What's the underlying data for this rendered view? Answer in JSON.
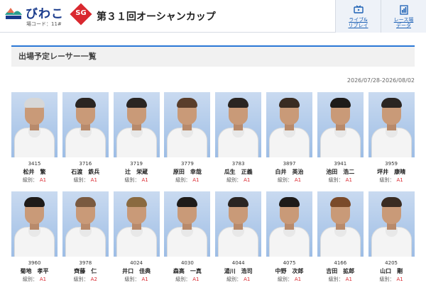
{
  "header": {
    "venue_name": "びわこ",
    "venue_code": "場コード：11#",
    "grade_badge": "SG",
    "race_title": "第３１回オーシャンカップ",
    "buttons": [
      {
        "label_line1": "ライブ&",
        "label_line2": "リプレイ",
        "icon": "tv-icon"
      },
      {
        "label_line1": "レース場",
        "label_line2": "データ",
        "icon": "chart-document-icon"
      }
    ]
  },
  "section": {
    "title": "出場予定レーサー一覧",
    "period": "2026/07/28-2026/08/02"
  },
  "grade_label": "級別：",
  "racers": [
    {
      "number": "3415",
      "name": "松井　繁",
      "class": "A1"
    },
    {
      "number": "3716",
      "name": "石渡　鉄兵",
      "class": "A1"
    },
    {
      "number": "3719",
      "name": "辻　栄蔵",
      "class": "A1"
    },
    {
      "number": "3779",
      "name": "原田　幸哉",
      "class": "A1"
    },
    {
      "number": "3783",
      "name": "瓜生　正義",
      "class": "A1"
    },
    {
      "number": "3897",
      "name": "白井　英治",
      "class": "A1"
    },
    {
      "number": "3941",
      "name": "池田　浩二",
      "class": "A1"
    },
    {
      "number": "3959",
      "name": "坪井　康晴",
      "class": "A1"
    },
    {
      "number": "3960",
      "name": "菊地　孝平",
      "class": "A1"
    },
    {
      "number": "3978",
      "name": "齊藤　仁",
      "class": "A2"
    },
    {
      "number": "4024",
      "name": "井口　佳典",
      "class": "A1"
    },
    {
      "number": "4030",
      "name": "森高　一真",
      "class": "A1"
    },
    {
      "number": "4044",
      "name": "湯川　浩司",
      "class": "A1"
    },
    {
      "number": "4075",
      "name": "中野　次郎",
      "class": "A1"
    },
    {
      "number": "4166",
      "name": "吉田　拡郎",
      "class": "A1"
    },
    {
      "number": "4205",
      "name": "山口　剛",
      "class": "A1"
    }
  ]
}
